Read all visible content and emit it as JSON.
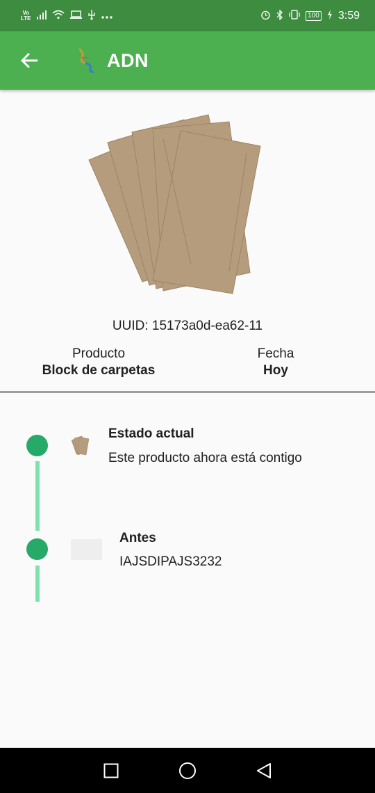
{
  "status_bar": {
    "volte_line1": "Vo",
    "volte_line2": "LTE",
    "battery": "100",
    "time": "3:59"
  },
  "app_bar": {
    "title": "ADN",
    "back_icon": "arrow-back-icon",
    "logo_icon": "dna-logo-icon"
  },
  "product": {
    "image_icon": "envelope-stack-image",
    "uuid_text": "UUID: 15173a0d-ea62-11",
    "product_label": "Producto",
    "product_value": "Block de carpetas",
    "date_label": "Fecha",
    "date_value": "Hoy"
  },
  "timeline": {
    "items": [
      {
        "title": "Estado actual",
        "text": "Este producto ahora está contigo"
      },
      {
        "title": "Antes",
        "text": "IAJSDIPAJS3232"
      }
    ]
  },
  "colors": {
    "status_bar": "#3d8c40",
    "app_bar": "#4caf50",
    "timeline_dot": "#27a96a",
    "timeline_line": "#7fe3b0"
  },
  "nav": {
    "icons": [
      "recents-square-icon",
      "home-circle-icon",
      "back-triangle-icon"
    ]
  }
}
